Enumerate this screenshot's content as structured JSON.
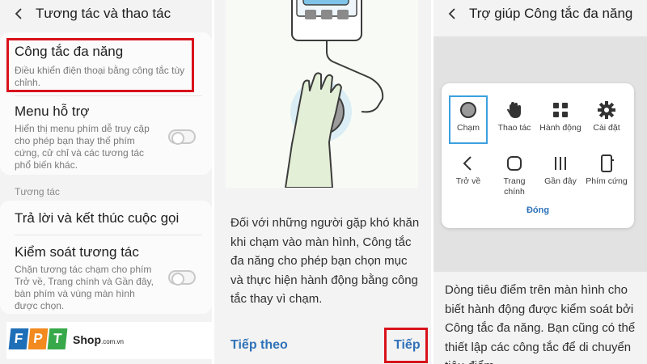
{
  "panel1": {
    "header": {
      "title": "Tương tác và thao tác"
    },
    "items": [
      {
        "title": "Công tắc đa năng",
        "subtitle": "Điều khiển điện thoại bằng công tắc tùy chỉnh."
      },
      {
        "title": "Menu hỗ trợ",
        "subtitle": "Hiển thị menu phím dễ truy cập cho phép bạn thay thế phím cứng, cử chỉ và các tương tác phổ biến khác.",
        "toggle_on": false
      }
    ],
    "section_label": "Tương tác",
    "items2": [
      {
        "title": "Trả lời và kết thúc cuộc gọi"
      },
      {
        "title": "Kiểm soát tương tác",
        "subtitle": "Chặn tương tác chạm cho phím Trở về, Trang chính và Gần đây, bàn phím và vùng màn hình được chọn.",
        "toggle_on": false
      }
    ]
  },
  "logo": {
    "letters": [
      "F",
      "P",
      "T"
    ],
    "shop": "Shop",
    "domain": ".com.vn"
  },
  "panel2": {
    "body": "Đối với những người gặp khó khăn khi chạm vào màn hình, Công tắc đa năng cho phép bạn chọn mục và thực hiện hành động bằng công tắc thay vì chạm.",
    "skip_label": "Tiếp theo",
    "next_label": "Tiếp"
  },
  "panel3": {
    "header": {
      "title": "Trợ giúp Công tắc đa năng"
    },
    "menu": [
      {
        "label": "Chạm",
        "icon": "circle-icon",
        "selected": true
      },
      {
        "label": "Thao tác",
        "icon": "hand-icon"
      },
      {
        "label": "Hành động",
        "icon": "apps-grid-icon"
      },
      {
        "label": "Cài đặt",
        "icon": "gear-icon"
      },
      {
        "label": "Trở về",
        "icon": "back-chevron-icon"
      },
      {
        "label": "Trang chính",
        "icon": "home-square-icon"
      },
      {
        "label": "Gần đây",
        "icon": "recents-icon"
      },
      {
        "label": "Phím cứng",
        "icon": "phone-icon"
      }
    ],
    "close_label": "Đóng",
    "body": "Dòng tiêu điểm trên màn hình cho biết hành động được kiểm soát bởi Công tắc đa năng. Bạn cũng có thể thiết lập các công tắc để di chuyển tiêu điểm."
  },
  "colors": {
    "highlight": "#d8121c",
    "link": "#2f72b8",
    "focus": "#3ba0e0",
    "fpt_blue": "#1f6fb8",
    "fpt_orange": "#f28a1f",
    "fpt_green": "#38a94a"
  }
}
